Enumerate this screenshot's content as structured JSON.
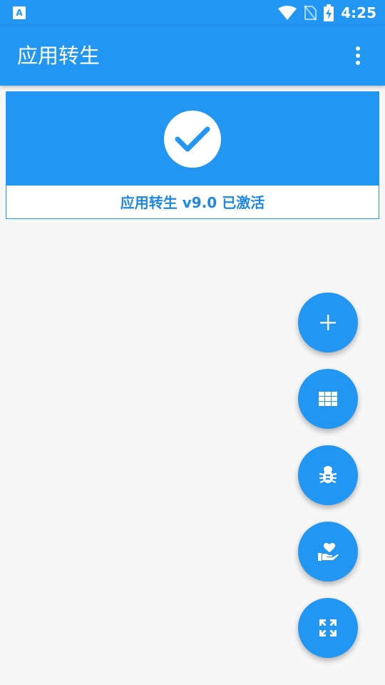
{
  "status_bar": {
    "time": "4:25",
    "icons": [
      "text-a-icon",
      "wifi-icon",
      "no-sim-icon",
      "battery-charging-icon"
    ]
  },
  "app_bar": {
    "title": "应用转生",
    "menu_icon": "more-vert-icon"
  },
  "status_card": {
    "icon": "check-icon",
    "text": "应用转生 v9.0 已激活"
  },
  "fabs": [
    {
      "name": "add-button",
      "icon": "plus-icon"
    },
    {
      "name": "apps-grid-button",
      "icon": "grid-icon"
    },
    {
      "name": "debug-button",
      "icon": "bug-icon"
    },
    {
      "name": "donate-button",
      "icon": "heart-hand-icon"
    },
    {
      "name": "expand-button",
      "icon": "expand-icon"
    }
  ],
  "colors": {
    "primary": "#2196f3",
    "card_text": "#1e88e5",
    "background": "#f7f7f7"
  }
}
